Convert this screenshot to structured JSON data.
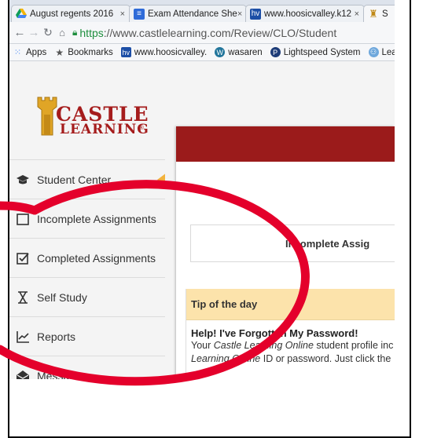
{
  "browser": {
    "tabs": [
      {
        "label": "August regents 2016",
        "icon": "drive-icon",
        "color": "#2c7ad6"
      },
      {
        "label": "Exam Attendance She",
        "icon": "sheets-icon",
        "color": "#2f6bd8"
      },
      {
        "label": "www.hoosicvalley.k12",
        "icon": "hv-icon",
        "color": "#1c4ea6"
      },
      {
        "label": "S",
        "icon": "castle-icon",
        "color": "#c08a1a"
      }
    ],
    "tab_close": "×",
    "url_scheme": "https",
    "url_rest": "://www.castlelearning.com/Review/CLO/Student",
    "bookmarks": [
      {
        "label": "Apps",
        "icon": "apps-icon"
      },
      {
        "label": "Bookmarks",
        "icon": "star-icon"
      },
      {
        "label": "www.hoosicvalley.",
        "icon": "hv-icon"
      },
      {
        "label": "wasaren",
        "icon": "wordpress-icon"
      },
      {
        "label": "Lightspeed System",
        "icon": "lightspeed-icon"
      },
      {
        "label": "Learnin",
        "icon": "learning-icon"
      }
    ]
  },
  "sidebar": {
    "logo_line1": "CASTLE",
    "logo_line2": "LEARNING",
    "logo_mark": "®",
    "items": [
      {
        "label": "Student Center",
        "icon": "graduation-cap-icon",
        "active": true
      },
      {
        "label": "Incomplete Assignments",
        "icon": "square-icon"
      },
      {
        "label": "Completed Assignments",
        "icon": "checkbox-icon"
      },
      {
        "label": "Self Study",
        "icon": "self-study-icon"
      },
      {
        "label": "Reports",
        "icon": "line-chart-icon"
      },
      {
        "label": "Messages",
        "icon": "envelope-icon"
      }
    ]
  },
  "main": {
    "incomplete_label": "Incomplete Assig",
    "tip_heading": "Tip of the day",
    "tip_title": "Help! I've Forgotten My Password!",
    "tip_line1_prefix": "Your ",
    "tip_line1_italic": "Castle Learning Online",
    "tip_line1_suffix": " student profile inc",
    "tip_line2_italic": "Learning Online",
    "tip_line2_suffix": " ID or password. Just click the"
  },
  "colors": {
    "header_red": "#9b1b1b",
    "tip_yellow": "#fce3ab",
    "pointer_orange": "#f3b33d",
    "annotation_red": "#e4002b",
    "logo_red": "#a51c1c"
  }
}
